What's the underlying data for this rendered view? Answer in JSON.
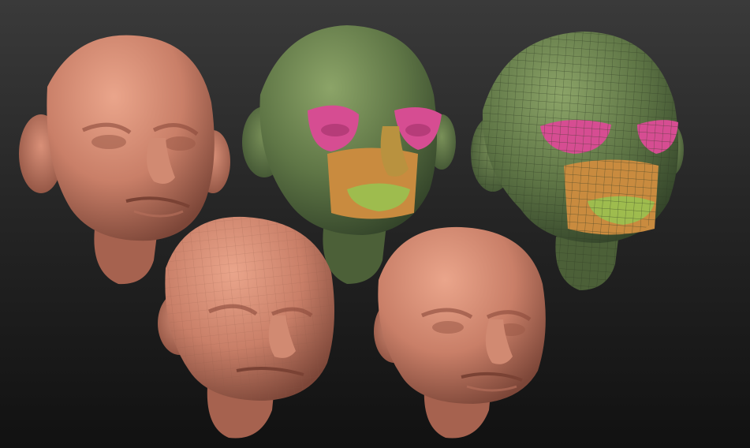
{
  "scene": {
    "heads": [
      {
        "name": "sculpt-head-smooth",
        "material": "skin",
        "polygroups": false,
        "wireframe": false
      },
      {
        "name": "sculpt-head-polygroups",
        "material": "green",
        "polygroups": true,
        "wireframe": false
      },
      {
        "name": "sculpt-head-polygroups-wireframe",
        "material": "green",
        "polygroups": true,
        "wireframe": true
      },
      {
        "name": "sculpt-head-lowpoly",
        "material": "skin",
        "polygroups": false,
        "wireframe": false,
        "faceted": true
      },
      {
        "name": "sculpt-head-detailed",
        "material": "skin",
        "polygroups": false,
        "wireframe": false
      }
    ]
  },
  "colors": {
    "background_top": "#3a3a3a",
    "background_bottom": "#111111",
    "skin": "#c97f68",
    "skin_light": "#e7a48b",
    "skin_dark": "#7c4638",
    "green": "#5f7646",
    "green_light": "#8ca468",
    "green_dark": "#34452a",
    "eye_group": "#d64d92",
    "mouth_group": "#c98b3f",
    "lip_group": "#9ebc4e",
    "wire": "#2d3a22"
  }
}
